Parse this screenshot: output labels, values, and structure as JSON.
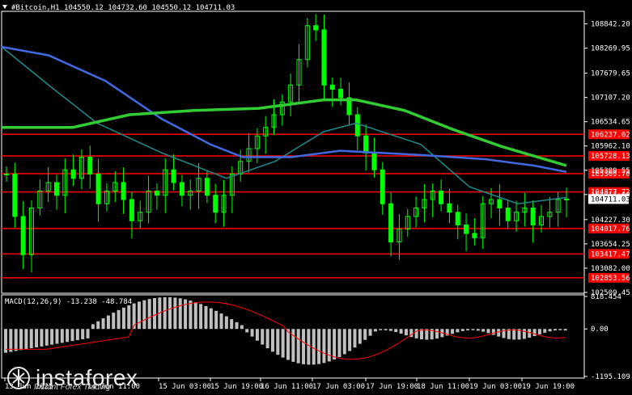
{
  "chart_header": {
    "symbol_info": "#Bitcoin,H1  104550.12 104732.60 104550.12 104711.03"
  },
  "price_axis": {
    "ticks": [
      "108842.20",
      "108269.95",
      "107679.65",
      "107107.20",
      "106534.65",
      "105962.10",
      "105389.55",
      "104817.00",
      "104227.30",
      "103654.25",
      "103082.00",
      "102509.45"
    ],
    "current_price": "104711.03",
    "current_color": "#ffffff"
  },
  "levels": [
    {
      "label": "106237.02",
      "value": 106237.02
    },
    {
      "label": "105728.13",
      "value": 105728.13
    },
    {
      "label": "105309.70",
      "value": 105309.7
    },
    {
      "label": "104877.72",
      "value": 104877.72
    },
    {
      "label": "104017.76",
      "value": 104017.76
    },
    {
      "label": "103417.47",
      "value": 103417.47
    },
    {
      "label": "102853.56",
      "value": 102853.56
    }
  ],
  "time_axis": [
    "13 Jun 2025",
    "14 Jun 11:00",
    "15 Jun 03:00",
    "15 Jun 19:00",
    "16 Jun 11:00",
    "17 Jun 03:00",
    "17 Jun 19:00",
    "18 Jun 11:00",
    "19 Jun 03:00",
    "19 Jun 19:00"
  ],
  "macd": {
    "label": "MACD(12,26,9) -13.238 -48.784",
    "ticks": [
      "818.454",
      "0.00",
      "-1195.109"
    ]
  },
  "colors": {
    "background": "#000000",
    "candle": "#00ff00",
    "level": "#ff0000",
    "ma_fast": "#1f8a8a",
    "ma_slow": "#4169e1",
    "ma_long": "#32cd32",
    "macd_hist": "#c0c0c0",
    "macd_signal": "#ff0000"
  },
  "watermark": {
    "brand": "instaforex",
    "tagline": "Instant Forex Trading"
  },
  "icons": [
    "collapse-triangle-icon",
    "instaforex-logo-icon"
  ],
  "chart_data": {
    "type": "line",
    "title": "#Bitcoin,H1",
    "y_range": [
      102509.45,
      109100
    ],
    "close_series": [
      105300,
      104300,
      103400,
      104500,
      104900,
      105100,
      104800,
      105400,
      105200,
      105700,
      105300,
      104600,
      104900,
      105100,
      104700,
      104200,
      104400,
      104900,
      104800,
      105400,
      105100,
      104800,
      104900,
      105200,
      104800,
      104400,
      104800,
      105300,
      105600,
      105900,
      106200,
      106400,
      106700,
      107000,
      107400,
      108000,
      108800,
      108700,
      107400,
      107300,
      107100,
      106700,
      106200,
      105800,
      105400,
      104600,
      103700,
      104000,
      104300,
      104500,
      104700,
      104900,
      104600,
      104400,
      104100,
      103900,
      103800,
      104600,
      104700,
      104500,
      104200,
      104400,
      104500,
      104100,
      104300,
      104400,
      104700,
      104711.03
    ]
  }
}
